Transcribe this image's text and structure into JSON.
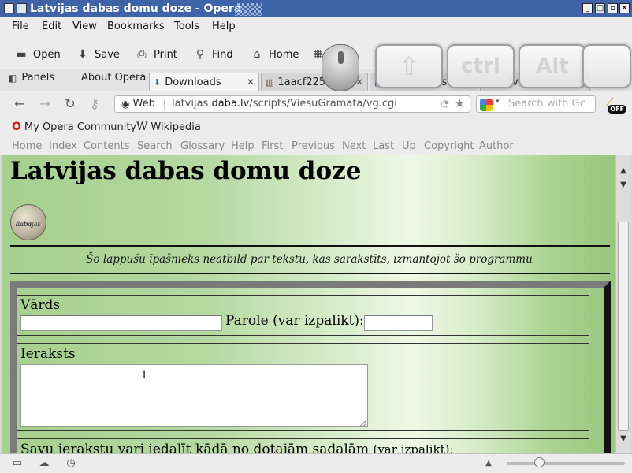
{
  "window": {
    "title": "Latvijas dabas domu doze - Opera",
    "controls": [
      "_",
      "□",
      "▢",
      "✕"
    ]
  },
  "menu": [
    "File",
    "Edit",
    "View",
    "Bookmarks",
    "Tools",
    "Help"
  ],
  "toolbar": {
    "open": "Open",
    "save": "Save",
    "print": "Print",
    "find": "Find",
    "home": "Home"
  },
  "tabs": {
    "panels": "Panels",
    "about": "About Opera",
    "downloads": "Downloads",
    "tab3": "1aacf225",
    "tab4": "s",
    "tab5": "tv"
  },
  "address": {
    "web_label": "Web",
    "url_prefix": "latvijas.",
    "url_domain": "daba.lv",
    "url_path": "/scripts/ViesuGramata/vg.cgi",
    "search_placeholder": "Search with Gc",
    "off_badge": "OFF"
  },
  "bookmarks": {
    "opera_community": "My Opera Community",
    "wikipedia": "Wikipedia"
  },
  "navbar": [
    "Home",
    "Index",
    "Contents",
    "Search",
    "Glossary",
    "Help",
    "First",
    "Previous",
    "Next",
    "Last",
    "Up",
    "Copyright",
    "Author"
  ],
  "page": {
    "heading": "Latvijas dabas domu doze",
    "logo_text_1": "Latvijas",
    "logo_text_2": "daba",
    "disclaimer": "Šo lappušu īpašnieks neatbild par tekstu, kas sarakstīts, izmantojot šo programmu",
    "name_label": "Vārds",
    "password_label": "Parole (var izpalikt):",
    "entry_label": "Ieraksts",
    "categories_label": "Savu ierakstu vari iedalīt kādā no dotajām sadaļām",
    "categories_optional": "(var izpalikt):"
  },
  "osk": {
    "shift": "⇧",
    "ctrl": "ctrl",
    "alt": "Alt"
  }
}
